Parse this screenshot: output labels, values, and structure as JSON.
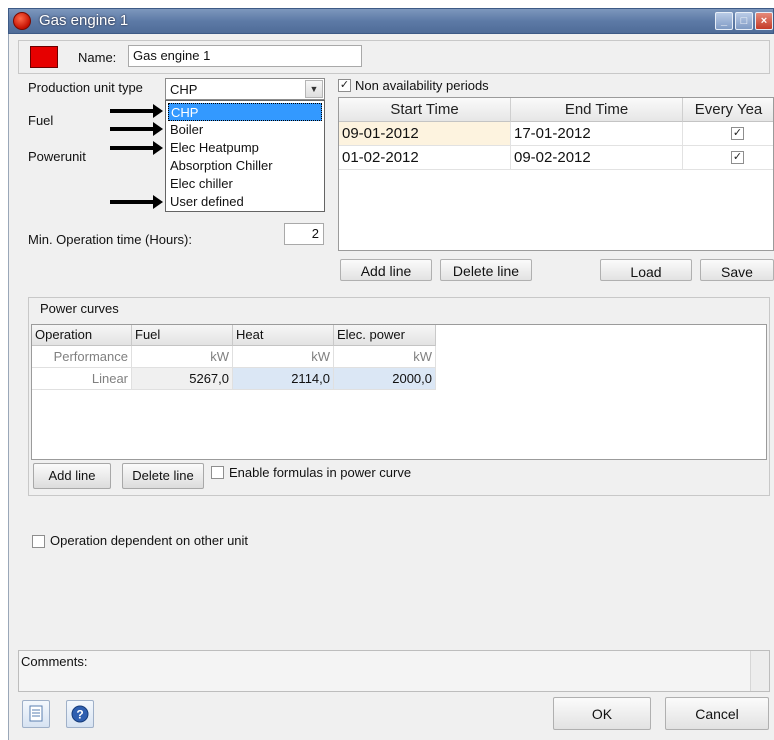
{
  "window": {
    "title": "Gas engine 1",
    "controls": [
      "minimize-icon",
      "maximize-icon",
      "close-icon"
    ],
    "control_glyphs": {
      "minimize": "_",
      "maximize": "□",
      "close": "×"
    }
  },
  "header": {
    "name_label": "Name:",
    "name_value": "Gas engine 1",
    "swatch_color": "#e60000"
  },
  "production": {
    "type_label": "Production unit type",
    "type_value": "CHP",
    "fuel_label": "Fuel",
    "powerunit_label": "Powerunit",
    "min_op_label": "Min. Operation time (Hours):",
    "min_op_value": "2",
    "options": [
      {
        "label": "CHP",
        "selected": true
      },
      {
        "label": "Boiler",
        "selected": false
      },
      {
        "label": "Elec Heatpump",
        "selected": false
      },
      {
        "label": "Absorption Chiller",
        "selected": false
      },
      {
        "label": "Elec chiller",
        "selected": false
      },
      {
        "label": "User defined",
        "selected": false
      }
    ]
  },
  "availability": {
    "checkbox_label": "Non availability periods",
    "checked": true,
    "check_glyph": "✓",
    "columns": [
      "Start Time",
      "End Time",
      "Every Yea"
    ],
    "rows": [
      {
        "start": "09-01-2012",
        "end": "17-01-2012",
        "every_year": true
      },
      {
        "start": "01-02-2012",
        "end": "09-02-2012",
        "every_year": true
      }
    ],
    "buttons": {
      "add": "Add line",
      "delete": "Delete line",
      "load": "Load",
      "save": "Save"
    }
  },
  "power_curves": {
    "title": "Power curves",
    "columns": [
      "Operation",
      "Fuel",
      "Heat",
      "Elec. power"
    ],
    "rows": [
      {
        "operation": "Performance",
        "fuel": "kW",
        "heat": "kW",
        "elec": "kW"
      },
      {
        "operation": "Linear",
        "fuel": "5267,0",
        "heat": "2114,0",
        "elec": "2000,0"
      }
    ],
    "buttons": {
      "add": "Add line",
      "delete": "Delete line"
    },
    "formulas_label": "Enable formulas in power curve",
    "formulas_checked": false
  },
  "dependency": {
    "label": "Operation dependent on other unit",
    "checked": false
  },
  "comments": {
    "label": "Comments:"
  },
  "footer": {
    "ok": "OK",
    "cancel": "Cancel",
    "left_icons": [
      "document-list-icon",
      "help-icon"
    ]
  },
  "colors": {
    "title_bar": "#5d7aa6",
    "selection": "#3399ff",
    "highlight_cell": "#fdf3df",
    "edit_cell": "#dbe7f5"
  }
}
